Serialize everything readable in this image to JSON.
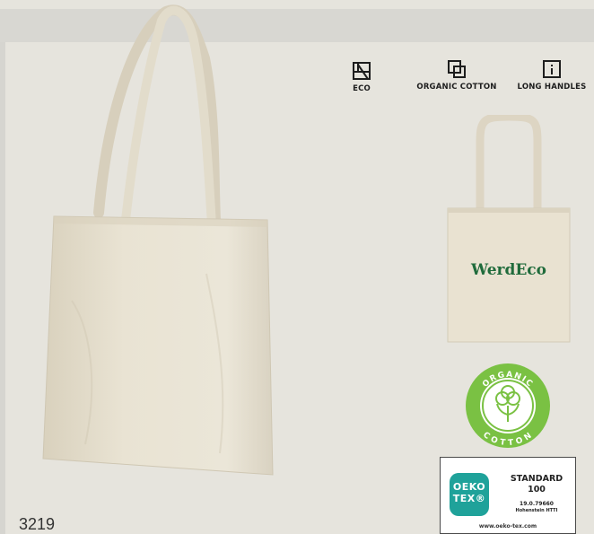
{
  "features": [
    {
      "label": "ECO",
      "icon": "eco-square-icon"
    },
    {
      "label": "ORGANIC COTTON",
      "icon": "overlapping-squares-icon"
    },
    {
      "label": "LONG HANDLES",
      "icon": "info-icon"
    }
  ],
  "product": {
    "sku": "3219",
    "print_brand": "WerdEco",
    "bag_color": "#e8e2d2",
    "brand_color": "#1f6b3b"
  },
  "organic_badge": {
    "top_text": "ORGANIC",
    "bottom_text": "COTTON",
    "color": "#7ac143"
  },
  "oeko_tex": {
    "logo_line1": "OEKO",
    "logo_line2": "TEX®",
    "standard": "STANDARD",
    "number": "100",
    "code": "19.0.79660",
    "institute": "Hohenstein HTTI",
    "url": "www.oeko-tex.com",
    "color": "#1fa29a"
  }
}
